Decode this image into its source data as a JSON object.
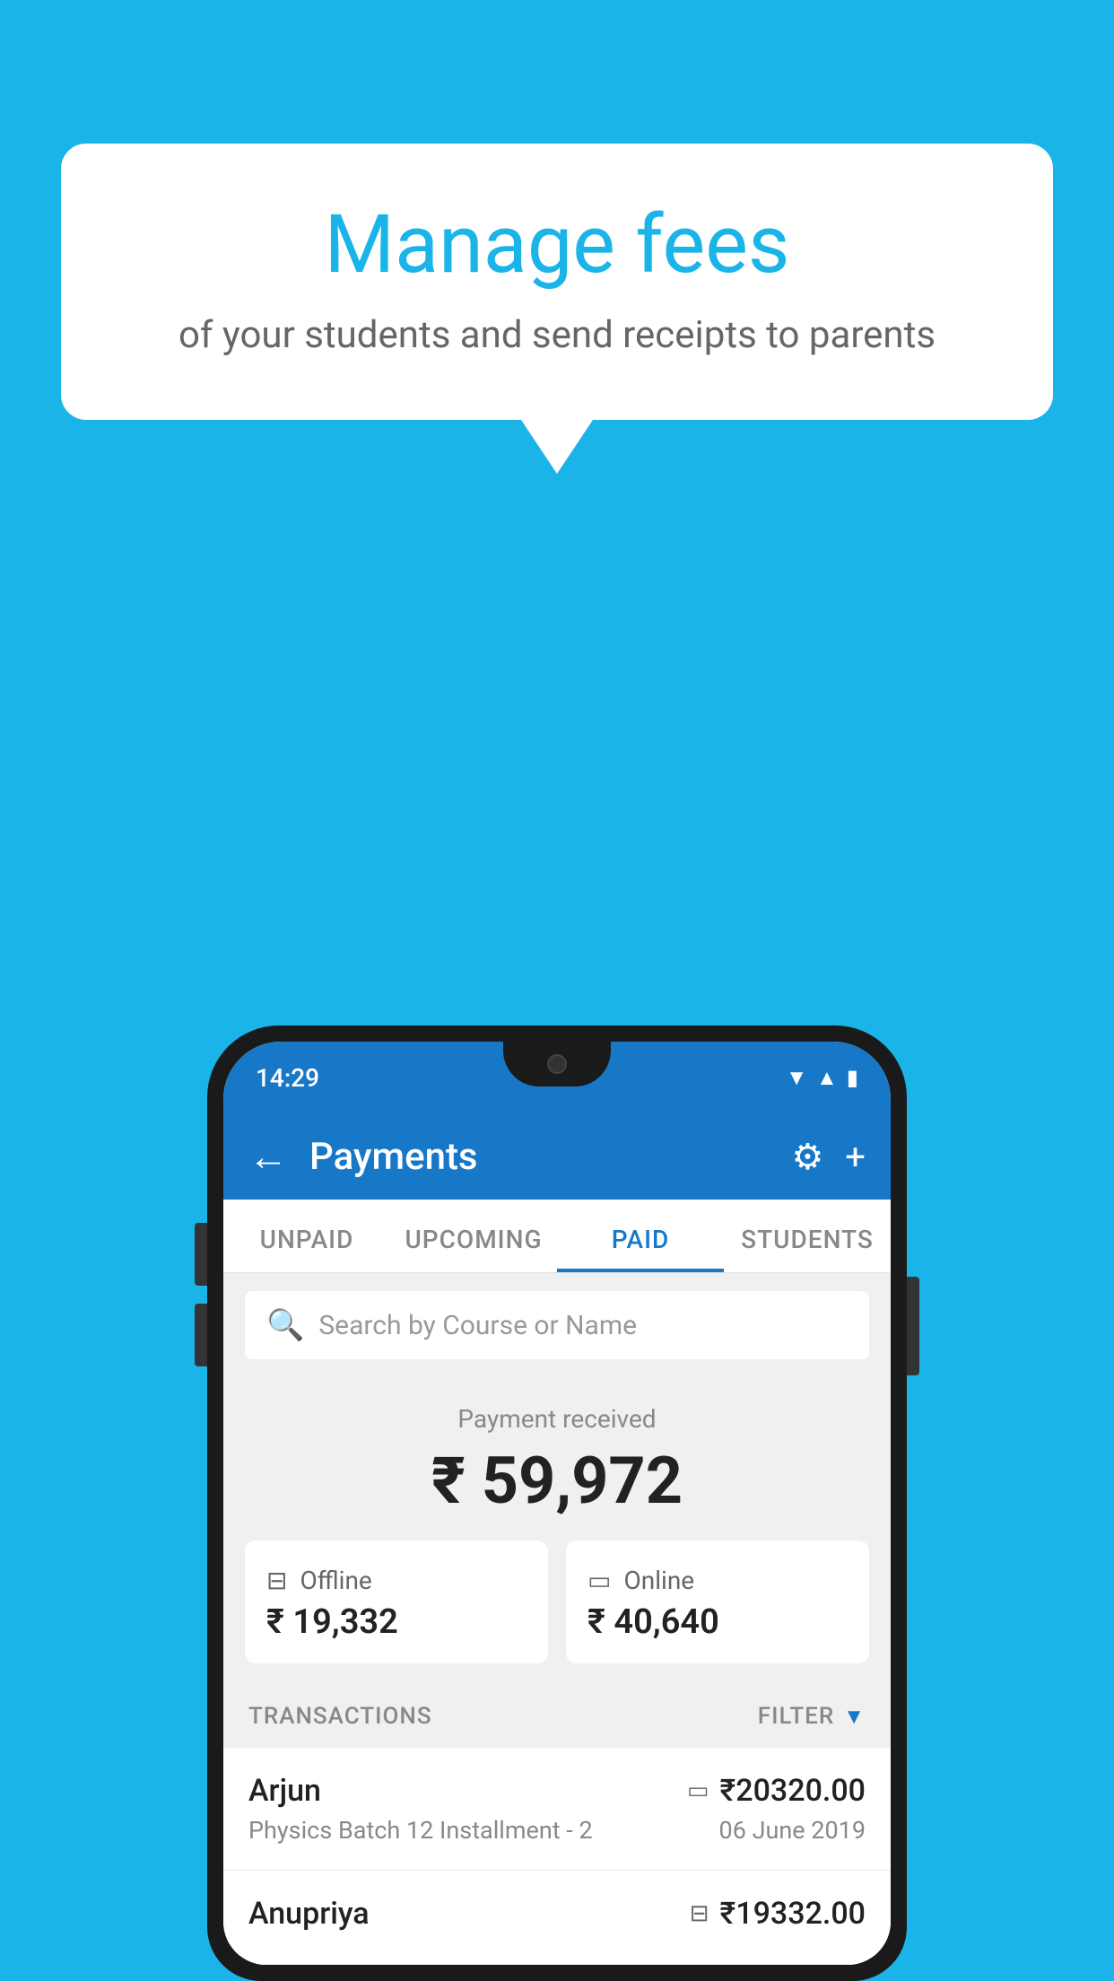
{
  "background_color": "#1ab4e8",
  "speech_bubble": {
    "title": "Manage fees",
    "subtitle": "of your students and send receipts to parents"
  },
  "status_bar": {
    "time": "14:29",
    "icons": [
      "wifi",
      "signal",
      "battery"
    ]
  },
  "header": {
    "title": "Payments",
    "back_label": "←",
    "settings_label": "⚙",
    "add_label": "+"
  },
  "tabs": [
    {
      "label": "UNPAID",
      "active": false
    },
    {
      "label": "UPCOMING",
      "active": false
    },
    {
      "label": "PAID",
      "active": true
    },
    {
      "label": "STUDENTS",
      "active": false
    }
  ],
  "search": {
    "placeholder": "Search by Course or Name"
  },
  "payment_summary": {
    "label": "Payment received",
    "amount": "₹ 59,972",
    "offline": {
      "label": "Offline",
      "amount": "₹ 19,332"
    },
    "online": {
      "label": "Online",
      "amount": "₹ 40,640"
    }
  },
  "transactions": {
    "header_label": "TRANSACTIONS",
    "filter_label": "FILTER",
    "rows": [
      {
        "name": "Arjun",
        "course": "Physics Batch 12 Installment - 2",
        "amount": "₹20320.00",
        "date": "06 June 2019",
        "type": "online"
      },
      {
        "name": "Anupriya",
        "course": "",
        "amount": "₹19332.00",
        "date": "",
        "type": "offline"
      }
    ]
  }
}
